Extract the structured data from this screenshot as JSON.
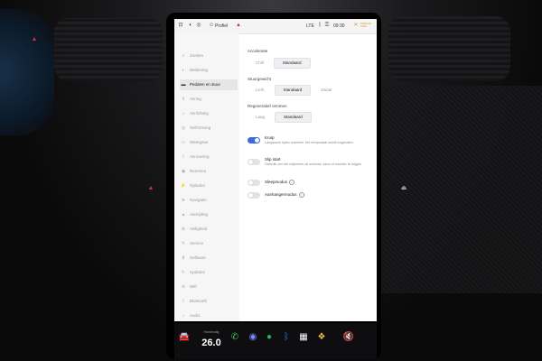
{
  "statusbar": {
    "profile_label": "Profiel",
    "time": "09:30",
    "lte": "LTE",
    "brand_line1": "PREMIUM",
    "brand_line2": "CARS"
  },
  "sidebar": {
    "items": [
      {
        "label": "Zoeken",
        "icon": "search-icon",
        "glyph": "⌕",
        "active": false
      },
      {
        "label": "Bediening",
        "icon": "toggles-icon",
        "glyph": "◐",
        "active": false
      },
      {
        "label": "Pedalen en stuur",
        "icon": "car-icon",
        "glyph": "▬",
        "active": true
      },
      {
        "label": "Vering",
        "icon": "suspension-icon",
        "glyph": "⇕",
        "active": false
      },
      {
        "label": "Verlichting",
        "icon": "light-icon",
        "glyph": "☼",
        "active": false
      },
      {
        "label": "Self-Driving",
        "icon": "steering-icon",
        "glyph": "◎",
        "active": false
      },
      {
        "label": "Weergave",
        "icon": "display-icon",
        "glyph": "▭",
        "active": false
      },
      {
        "label": "Vervoering",
        "icon": "trip-icon",
        "glyph": "⌇",
        "active": false
      },
      {
        "label": "Opladen",
        "icon": "charging-icon",
        "glyph": "⚡",
        "active": false
      },
      {
        "label": "Navigatie",
        "icon": "navigation-icon",
        "glyph": "➤",
        "active": false
      },
      {
        "label": "Veiligheid",
        "icon": "safety-icon",
        "glyph": "⊕",
        "active": false
      },
      {
        "label": "Service",
        "icon": "wrench-icon",
        "glyph": "✎",
        "active": false
      },
      {
        "label": "Software",
        "icon": "software-icon",
        "glyph": "⬇",
        "active": false
      },
      {
        "label": "Updates",
        "icon": "update-icon",
        "glyph": "↻",
        "active": false
      },
      {
        "label": "Wifi",
        "icon": "wifi-icon",
        "glyph": "≋",
        "active": false
      },
      {
        "label": "Bluetooth",
        "icon": "bluetooth-icon",
        "glyph": "ᛒ",
        "active": false
      },
      {
        "label": "Audio",
        "icon": "audio-icon",
        "glyph": "♪",
        "active": false
      }
    ],
    "hidden_items": [
      {
        "label": "Remmen",
        "icon": "brake-icon",
        "glyph": "◉"
      },
      {
        "label": "Aanrijding",
        "icon": "collision-icon",
        "glyph": "▲"
      }
    ]
  },
  "main": {
    "acceleration": {
      "title": "Acceleratie",
      "options": [
        "Chill",
        "Standaard"
      ],
      "selected": "Standaard"
    },
    "steering": {
      "title": "Stuurgewicht",
      "options": [
        "Licht",
        "Standaard",
        "Zwaar"
      ],
      "selected": "Standaard"
    },
    "regen": {
      "title": "Regeneratief remmen",
      "options": [
        "Laag",
        "Standaard"
      ],
      "selected": "Standaard"
    },
    "toggles": [
      {
        "label": "Kruip",
        "desc": "Langzaam rijden wanneer het rempedaal wordt losgelaten",
        "on": true
      },
      {
        "label": "Slip start",
        "desc": "Gebruik om het vrijkomen uit sneeuw, zand of modder te krijgen",
        "on": false
      },
      {
        "label": "Sleepmodus",
        "desc": "",
        "on": false
      },
      {
        "label": "Aanhangermodus",
        "desc": "",
        "on": false
      }
    ]
  },
  "dock": {
    "temp_label": "Handmatig",
    "temp_value": "26.0",
    "temp_unit": "",
    "icons": [
      "car-icon",
      "phone-icon",
      "media-icon",
      "spotify-icon",
      "bluetooth-icon",
      "calendar-icon",
      "apps-icon",
      "mute-icon"
    ]
  },
  "colors": {
    "accent": "#3e6ae1",
    "alert": "#cc3333"
  }
}
